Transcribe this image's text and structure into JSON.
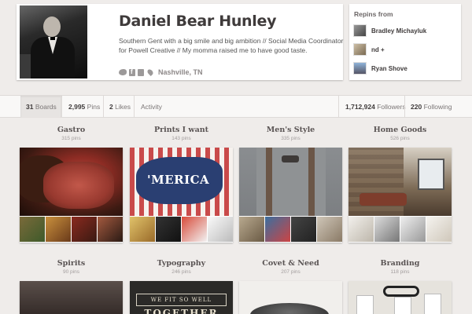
{
  "profile": {
    "name": "Daniel Bear Hunley",
    "bio": "Southern Gent with a big smile and big ambition // Social Media Coordinator for Powell Creative // My momma raised me to have good taste.",
    "location": "Nashville, TN",
    "social_icons": [
      "twitter-icon",
      "facebook-icon",
      "website-icon",
      "location-pin-icon"
    ]
  },
  "repins": {
    "title": "Repins from",
    "users": [
      {
        "name": "Bradley Michayluk"
      },
      {
        "name": "nd +"
      },
      {
        "name": "Ryan Shove"
      }
    ]
  },
  "stats": {
    "boards_count": "31",
    "boards_label": "Boards",
    "pins_count": "2,995",
    "pins_label": "Pins",
    "likes_count": "2",
    "likes_label": "Likes",
    "activity_label": "Activity",
    "followers_count": "1,712,924",
    "followers_label": "Followers",
    "following_count": "220",
    "following_label": "Following"
  },
  "boards": [
    {
      "title": "Gastro",
      "count": "315 pins"
    },
    {
      "title": "Prints I want",
      "count": "143 pins"
    },
    {
      "title": "Men's Style",
      "count": "335 pins"
    },
    {
      "title": "Home Goods",
      "count": "526 pins"
    },
    {
      "title": "Spirits",
      "count": "90 pins"
    },
    {
      "title": "Typography",
      "count": "246 pins"
    },
    {
      "title": "Covet & Need",
      "count": "207 pins"
    },
    {
      "title": "Branding",
      "count": "118 pins"
    }
  ],
  "cover_text": {
    "prints": "'MERICA",
    "typography_1": "WE FIT SO WELL",
    "typography_2": "TOGETHER"
  }
}
